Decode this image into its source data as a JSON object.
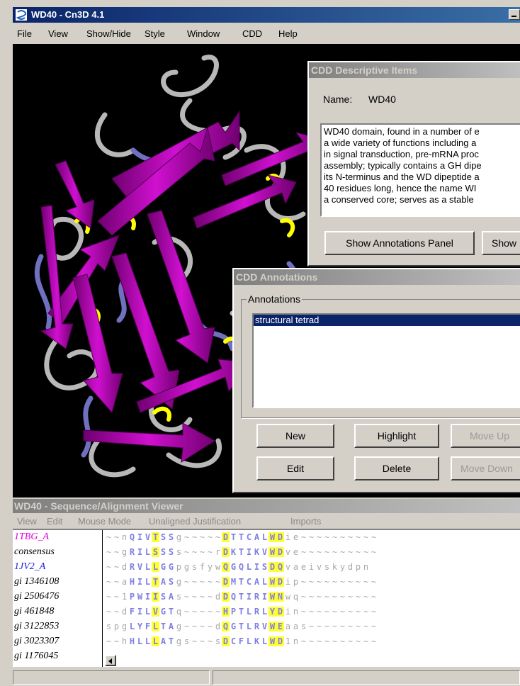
{
  "window": {
    "title": "WD40 - Cn3D 4.1"
  },
  "menu": [
    "File",
    "View",
    "Show/Hide",
    "Style",
    "Window",
    "CDD",
    "Help"
  ],
  "descriptive": {
    "title": "CDD Descriptive Items",
    "name_label": "Name:",
    "name_value": "WD40",
    "description_lines": [
      "WD40 domain, found in a number of e",
      "a wide variety of functions including a",
      "in signal transduction, pre-mRNA proc",
      "assembly; typically contains a GH dipe",
      "its N-terminus and the WD dipeptide a",
      "40 residues long, hence the name WI",
      "a conserved core; serves as a stable"
    ],
    "btn_annotations": "Show Annotations Panel",
    "btn_show": "Show"
  },
  "annotations": {
    "title": "CDD Annotations",
    "group_label": "Annotations",
    "items": [
      "structural tetrad"
    ],
    "btn_new": "New",
    "btn_highlight": "Highlight",
    "btn_move_up": "Move Up",
    "btn_edit": "Edit",
    "btn_delete": "Delete",
    "btn_move_down": "Move Down"
  },
  "seqviewer": {
    "title": "WD40 - Sequence/Alignment Viewer",
    "menu": [
      "View",
      "Edit",
      "Mouse Mode",
      "Unaligned Justification",
      "Imports"
    ],
    "rows": [
      {
        "name": "1TBG_A",
        "name_color": "#e000e0",
        "seq": "~~nQIVTSSg~~~~~DTTCALWDie~~~~~~~~~~"
      },
      {
        "name": "consensus",
        "name_color": "#000000",
        "seq": "~~gRILSSSs~~~~rDKTIKVWDve~~~~~~~~~~"
      },
      {
        "name": "1JV2_A",
        "name_color": "#2020e0",
        "seq": "~~dRVLLGGpgsfywQGQLISDQvaeivskydpn"
      },
      {
        "name": "gi 1346108",
        "name_color": "#000000",
        "seq": "~~aHILTASg~~~~~DMTCALWDip~~~~~~~~~~"
      },
      {
        "name": "gi 2506476",
        "name_color": "#000000",
        "seq": "~~1PWIISAs~~~~dDQTIRIWNwq~~~~~~~~~~"
      },
      {
        "name": "gi 461848",
        "name_color": "#000000",
        "seq": "~~dFILVGTq~~~~~HPTLRLYDin~~~~~~~~~~"
      },
      {
        "name": "gi 3122853",
        "name_color": "#000000",
        "seq": "spgLYFLTAg~~~~dQGTLRVWEaas~~~~~~~~~"
      },
      {
        "name": "gi 3023307",
        "name_color": "#000000",
        "seq": "~~hHLLLATgs~~~sDCFLKLWD1n~~~~~~~~~~"
      },
      {
        "name": "gi 1176045",
        "name_color": "#000000",
        "seq": ""
      }
    ],
    "highlight_columns": [
      6,
      15,
      21,
      22
    ]
  },
  "colors": {
    "strand": "#c000c0",
    "coil": "#b8b8b8",
    "helix_end": "#7070c0",
    "tetrad": "#ffff00",
    "selection": "#0a246a"
  }
}
